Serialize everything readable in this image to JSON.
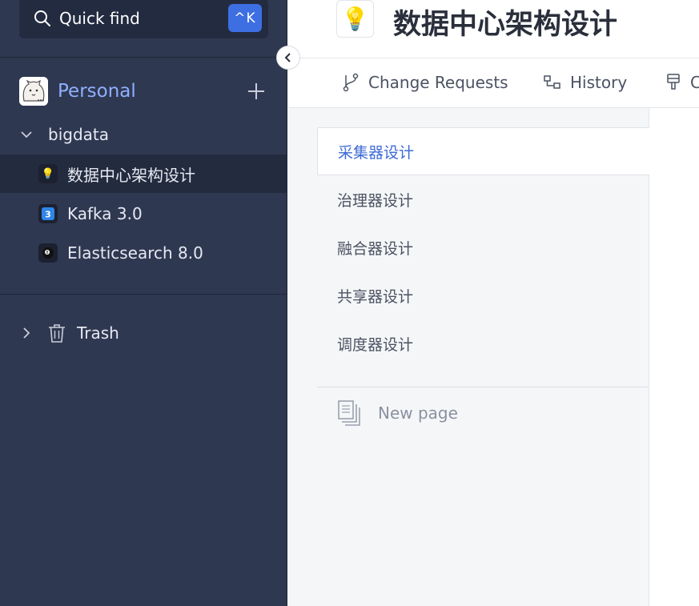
{
  "sidebar": {
    "quick_find": {
      "label": "Quick find",
      "shortcut": "^K"
    },
    "space": {
      "name": "Personal"
    },
    "tree": {
      "group": "bigdata",
      "items": [
        {
          "label": "数据中心架构设计",
          "icon": "lightbulb-icon",
          "selected": true
        },
        {
          "label": "Kafka 3.0",
          "icon": "number-3-icon",
          "selected": false
        },
        {
          "label": "Elasticsearch 8.0",
          "icon": "eight-ball-icon",
          "selected": false
        }
      ]
    },
    "trash": {
      "label": "Trash"
    }
  },
  "main": {
    "title": "数据中心架构设计",
    "tabs": [
      {
        "label": "Change Requests",
        "icon": "branch-icon"
      },
      {
        "label": "History",
        "icon": "history-icon"
      },
      {
        "label": "C",
        "icon": "brush-icon"
      }
    ],
    "toc": [
      {
        "label": "采集器设计",
        "active": true
      },
      {
        "label": "治理器设计",
        "active": false
      },
      {
        "label": "融合器设计",
        "active": false
      },
      {
        "label": "共享器设计",
        "active": false
      },
      {
        "label": "调度器设计",
        "active": false
      }
    ],
    "new_page_label": "New page"
  },
  "colors": {
    "sidebar_bg": "#2f3851",
    "accent": "#3d6fe3",
    "space_name": "#8fb0ff",
    "toc_active": "#3d6ad6"
  }
}
